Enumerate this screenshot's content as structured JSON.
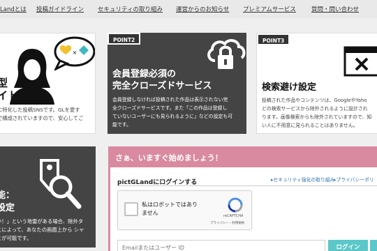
{
  "nav": {
    "items": [
      "Landとは",
      "投稿ガイドライン",
      "セキュリティの取り組み",
      "運営からのお知らせ",
      "プレミアムサービス",
      "質問・問い合わせ"
    ]
  },
  "cards": {
    "left_top": {
      "title_line1": "型",
      "title_line2": "イト",
      "desc_line1": "に特化した投稿SNSです。GLを愛す",
      "desc_line2": "で構成されていますので、安心してご"
    },
    "point2": {
      "badge": "POINT2",
      "title_line1": "会員登録必須の",
      "title_line2": "完全クローズドサービス",
      "desc_line1": "会員登録しなければ投稿された作品は表示されない完",
      "desc_line2": "全クローズドサービスです。また「この作品は登録し",
      "desc_line3": "ていないユーザーにも見られるように」などの設定も可",
      "desc_line4": "能です。"
    },
    "point3": {
      "badge": "POINT3",
      "title": "検索避け設定",
      "desc_line1": "投稿された作品やコンテンツは、GoogleやYaho",
      "desc_line2": "どの検索サービスから除外されるように設計され",
      "desc_line3": "ります。画像検索からも除外されていますので、知",
      "desc_line4": "い人に不用意に見られることはありません。"
    },
    "left_bottom": {
      "title_line1": "能：",
      "title_line2": "設定",
      "desc_line1": "い！」という地雷がある場合、除外タ",
      "desc_line2": "とによって、あなたの画面上から シャ",
      "desc_line3": "とが可能です。"
    }
  },
  "login": {
    "header": "さぁ、いますぐ始めましょう！",
    "title": "pictGLandにログインする",
    "link_security": "セキュリティ強化の取り組み",
    "link_privacy": "プライバシーポリ",
    "captcha_text_line1": "私はロボットではあり",
    "captcha_text_line2": "ません",
    "captcha_brand": "reCAPTCHA",
    "captcha_terms": "プライバシー・利用規約",
    "email_placeholder": "Emailまたはユーザー ID",
    "login_button": "ログイン"
  },
  "colors": {
    "dark_card": "#444444",
    "login_header": "#d98aa0",
    "login_button": "#5bc7c8",
    "link": "#2f6fb5"
  }
}
